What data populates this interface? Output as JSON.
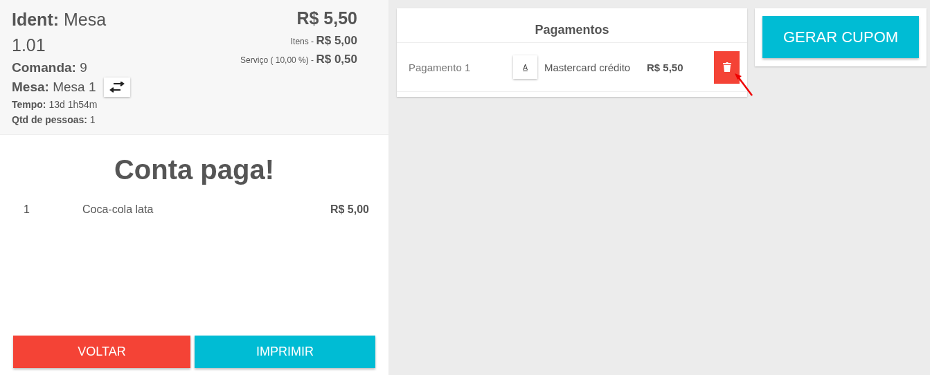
{
  "header": {
    "ident": {
      "label": "Ident:",
      "value": "Mesa 1.01"
    },
    "comanda": {
      "label": "Comanda:",
      "value": "9"
    },
    "mesa": {
      "label": "Mesa:",
      "value": "Mesa 1"
    },
    "tempo": {
      "label": "Tempo:",
      "value": "13d 1h54m"
    },
    "pessoas": {
      "label": "Qtd de pessoas:",
      "value": "1"
    },
    "total": "R$ 5,50",
    "itens": {
      "label": "Itens -",
      "value": "R$ 5,00"
    },
    "servico": {
      "label": "Serviço ( 10,00 %) -",
      "value": "R$ 0,50"
    }
  },
  "status": "Conta paga!",
  "items": [
    {
      "qty": "1",
      "name": "Coca-cola lata",
      "price": "R$ 5,00"
    }
  ],
  "buttons": [
    {
      "label": "VOLTAR",
      "kind": "danger"
    },
    {
      "label": "IMPRIMIR",
      "kind": "primary"
    }
  ],
  "payments": {
    "title": "Pagamentos",
    "rows": [
      {
        "name": "Pagamento 1",
        "badge": "A",
        "method": "Mastercard crédito",
        "amount": "R$ 5,50"
      }
    ]
  },
  "generate_button": "GERAR CUPOM"
}
